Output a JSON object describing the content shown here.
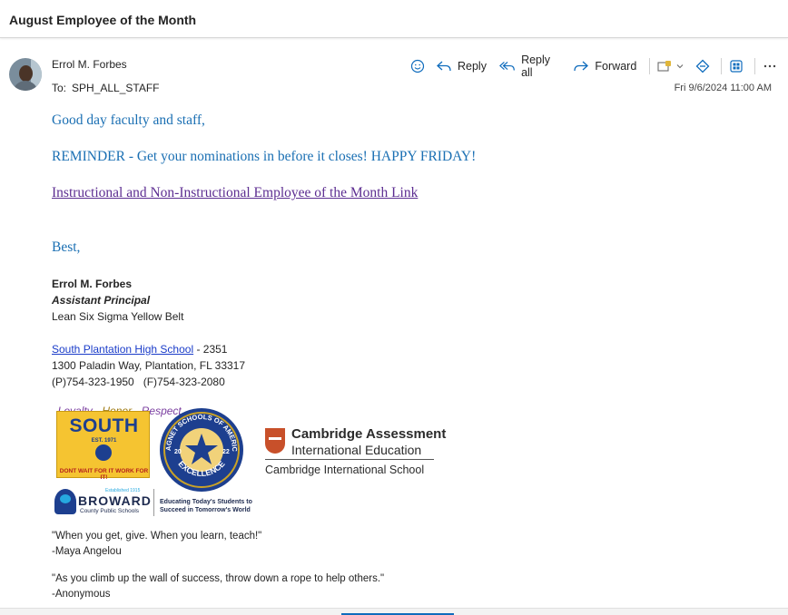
{
  "email": {
    "subject": "August Employee of the Month",
    "sender": "Errol M. Forbes",
    "to_label": "To:",
    "to_value": "SPH_ALL_STAFF",
    "date": "Fri 9/6/2024 11:00 AM"
  },
  "toolbar": {
    "reply": "Reply",
    "reply_all": "Reply all",
    "forward": "Forward"
  },
  "body": {
    "greeting": "Good day faculty and staff,",
    "reminder": "REMINDER - Get your nominations in before it closes! HAPPY FRIDAY!",
    "link": "Instructional and Non-Instructional Employee of the Month Link",
    "closing": "Best,"
  },
  "signature": {
    "name": "Errol M. Forbes",
    "title": "Assistant Principal",
    "cert": "Lean Six Sigma Yellow Belt",
    "school_link": "South Plantation High School",
    "school_suffix": " - 2351",
    "address": "1300 Paladin Way, Plantation, FL 33317",
    "phone": "(P)754-323-1950   (F)754-323-2080",
    "motto_loyalty": "Loyalty",
    "motto_sep": " - ",
    "motto_honor": "Honor",
    "motto_respect": "Respect"
  },
  "logos": {
    "south": {
      "name": "SOUTH",
      "est": "EST. 1971",
      "tag": "DONT WAIT FOR IT WORK FOR IT!"
    },
    "magnet": {
      "top_text": "MAGNET SCHOOLS OF AMERICA",
      "year_left": "20",
      "year_right": "22",
      "bottom_text": "EXCELLENCE"
    },
    "cambridge": {
      "line1": "Cambridge Assessment",
      "line2": "International Education",
      "line3": "Cambridge International School"
    },
    "broward": {
      "est": "Established 1915",
      "name": "BROWARD",
      "sub": "County Public Schools",
      "tag1": "Educating Today's Students to",
      "tag2": "Succeed in Tomorrow's World"
    }
  },
  "quotes": [
    {
      "text": "\"When you get, give. When you learn, teach!\"",
      "author": "-Maya Angelou"
    },
    {
      "text": "\"As you climb up the wall of success, throw down a rope to help others.\"",
      "author": "-Anonymous"
    }
  ],
  "colors": {
    "body_text": "#1a6fb3",
    "link_visited": "#5c2d91",
    "school_link": "#1a3cc9",
    "accent": "#0f6cbd"
  }
}
